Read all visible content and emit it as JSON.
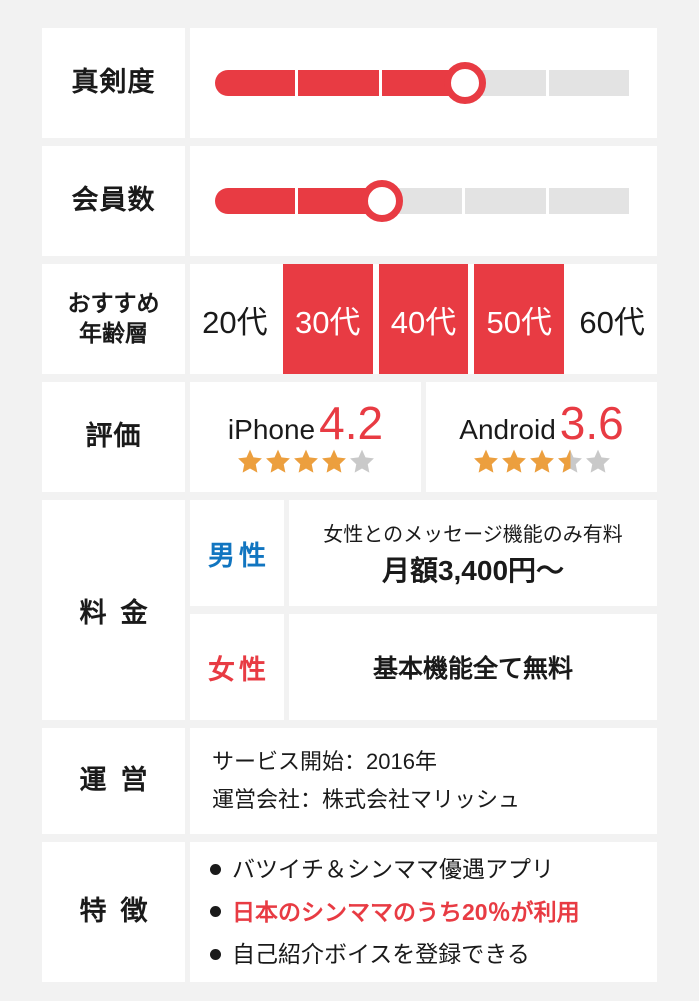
{
  "theme": {
    "accent_red": "#e83b43",
    "star_orange": "#ec9f3e",
    "star_gray": "#c9c9c9",
    "male_blue": "#1175c0",
    "page_bg": "#f2f2f2",
    "card_bg": "#ffffff"
  },
  "rows": {
    "seriousness": {
      "label": "真剣度",
      "segments_total": 5,
      "segments_filled": 3
    },
    "members": {
      "label": "会員数",
      "segments_total": 5,
      "segments_filled": 2
    },
    "age": {
      "label_line1": "おすすめ",
      "label_line2": "年齢層",
      "cells": [
        {
          "text": "20代",
          "highlighted": false
        },
        {
          "text": "30代",
          "highlighted": true
        },
        {
          "text": "40代",
          "highlighted": true
        },
        {
          "text": "50代",
          "highlighted": true
        },
        {
          "text": "60代",
          "highlighted": false
        }
      ]
    },
    "rating": {
      "label": "評価",
      "items": [
        {
          "os": "iPhone",
          "score": "4.2",
          "stars_full": 4,
          "stars_half": 0,
          "stars_empty": 1
        },
        {
          "os": "Android",
          "score": "3.6",
          "stars_full": 3,
          "stars_half": 1,
          "stars_empty": 1
        }
      ]
    },
    "fee": {
      "label": "料金",
      "male": {
        "gender": "男性",
        "note": "女性とのメッセージ機能のみ有料",
        "price": "月額3,400円〜"
      },
      "female": {
        "gender": "女性",
        "note": "基本機能全て無料"
      }
    },
    "operation": {
      "label": "運営",
      "lines": [
        "サービス開始：2016年",
        "運営会社：株式会社マリッシュ"
      ]
    },
    "features": {
      "label": "特徴",
      "items": [
        {
          "text": "バツイチ＆シンママ優遇アプリ",
          "highlighted": false
        },
        {
          "text": "日本のシンママのうち20％が利用",
          "highlighted": true
        },
        {
          "text": "自己紹介ボイスを登録できる",
          "highlighted": false
        }
      ]
    }
  }
}
